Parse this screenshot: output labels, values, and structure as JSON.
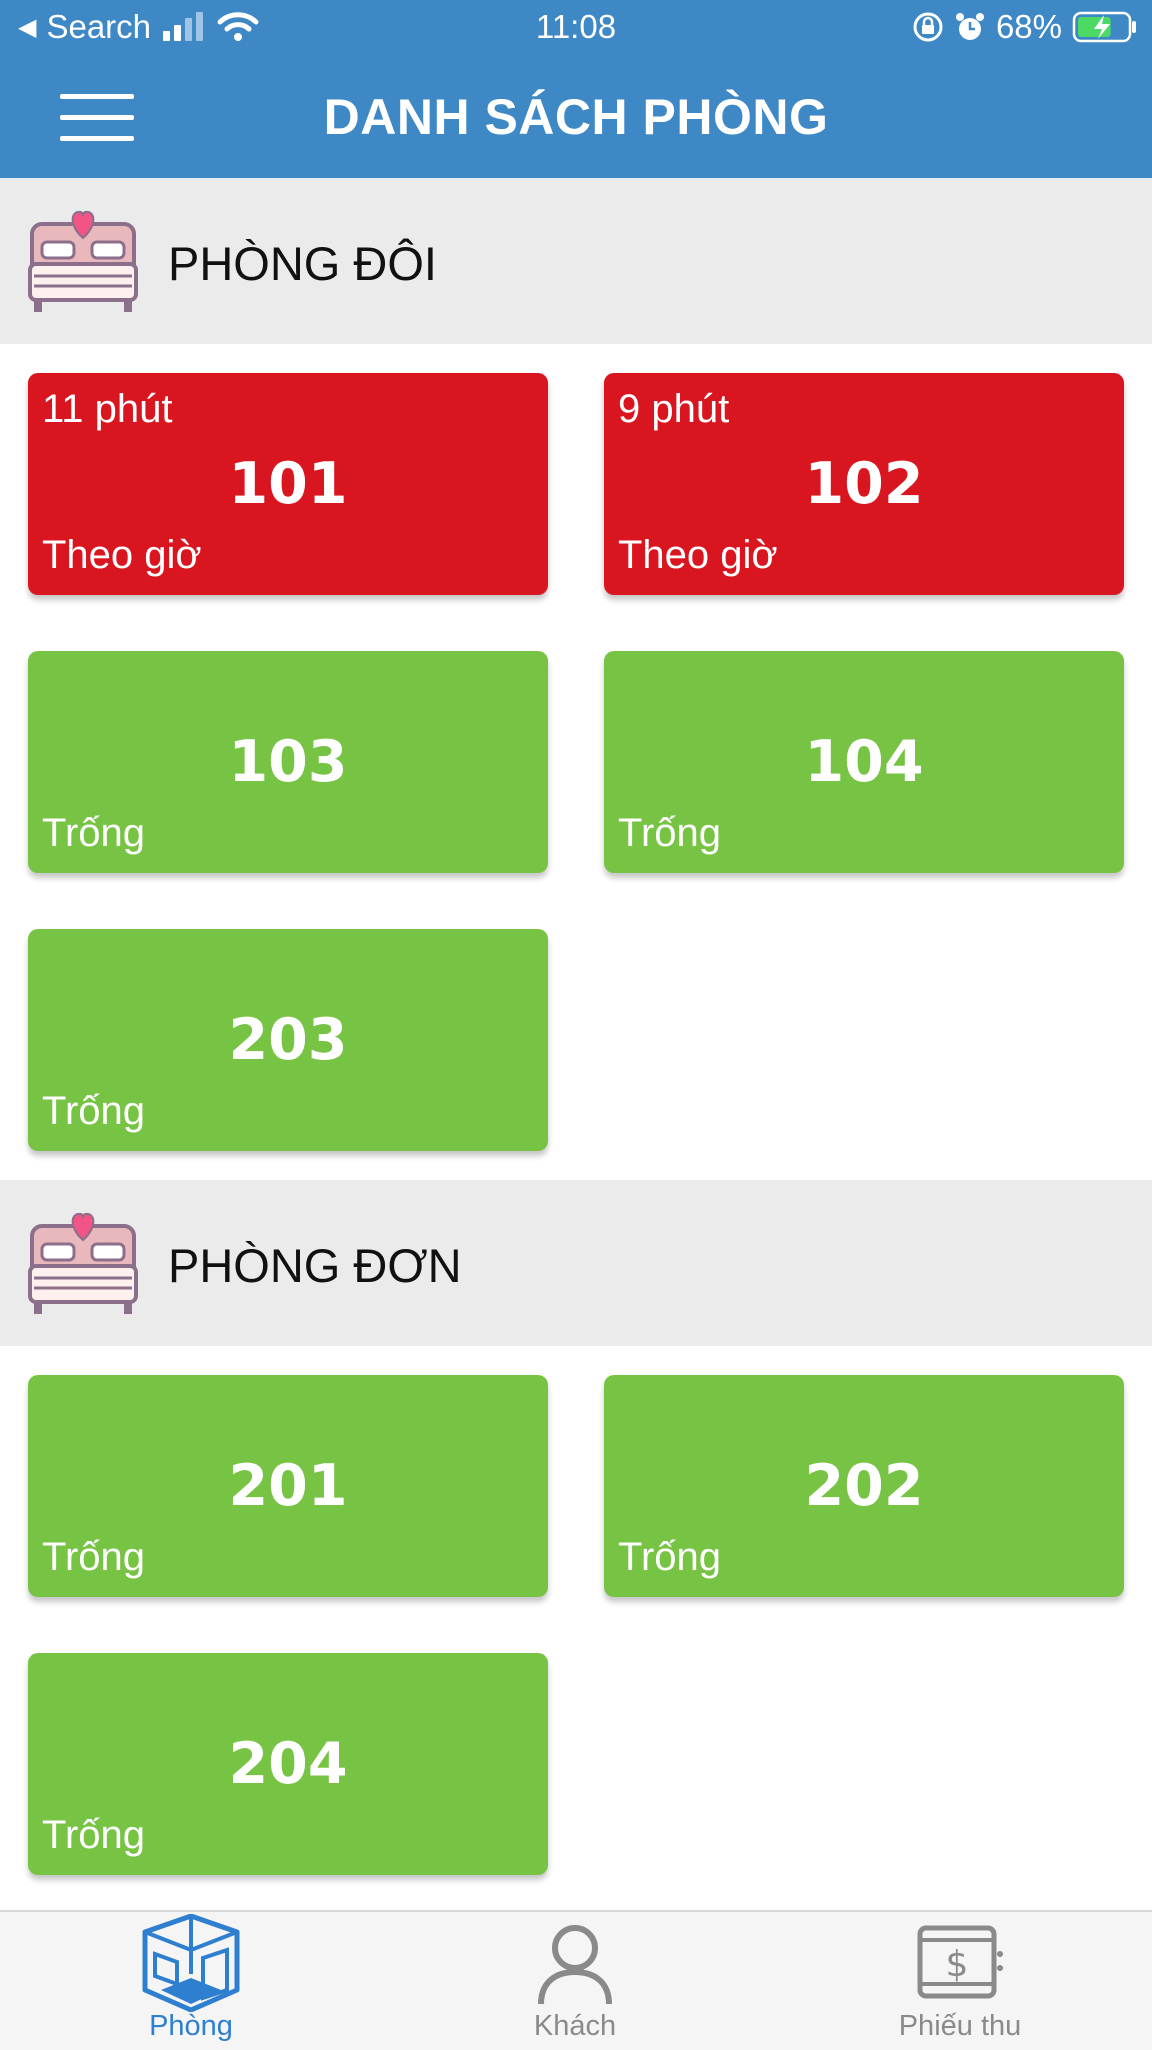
{
  "status_bar": {
    "back_label": "Search",
    "time": "11:08",
    "battery_percent": "68%",
    "battery_level": 0.68
  },
  "header": {
    "title": "DANH SÁCH PHÒNG"
  },
  "sections": [
    {
      "title": "PHÒNG ĐÔI",
      "icon": "bed-icon",
      "rooms": [
        {
          "timer": "11 phút",
          "number": "101",
          "status": "Theo giờ",
          "state": "busy"
        },
        {
          "timer": "9 phút",
          "number": "102",
          "status": "Theo giờ",
          "state": "busy"
        },
        {
          "timer": "",
          "number": "103",
          "status": "Trống",
          "state": "free"
        },
        {
          "timer": "",
          "number": "104",
          "status": "Trống",
          "state": "free"
        },
        {
          "timer": "",
          "number": "203",
          "status": "Trống",
          "state": "free"
        }
      ]
    },
    {
      "title": "PHÒNG ĐƠN",
      "icon": "bed-icon",
      "rooms": [
        {
          "timer": "",
          "number": "201",
          "status": "Trống",
          "state": "free"
        },
        {
          "timer": "",
          "number": "202",
          "status": "Trống",
          "state": "free"
        },
        {
          "timer": "",
          "number": "204",
          "status": "Trống",
          "state": "free"
        }
      ]
    }
  ],
  "tabs": [
    {
      "label": "Phòng",
      "icon": "room-icon",
      "active": true
    },
    {
      "label": "Khách",
      "icon": "person-icon",
      "active": false
    },
    {
      "label": "Phiếu thu",
      "icon": "receipt-icon",
      "active": false
    }
  ],
  "colors": {
    "header": "#3d88c5",
    "busy": "#d9161f",
    "free": "#77c344",
    "tab_active": "#2e7fd0",
    "tab_inactive": "#8a8a8a"
  }
}
